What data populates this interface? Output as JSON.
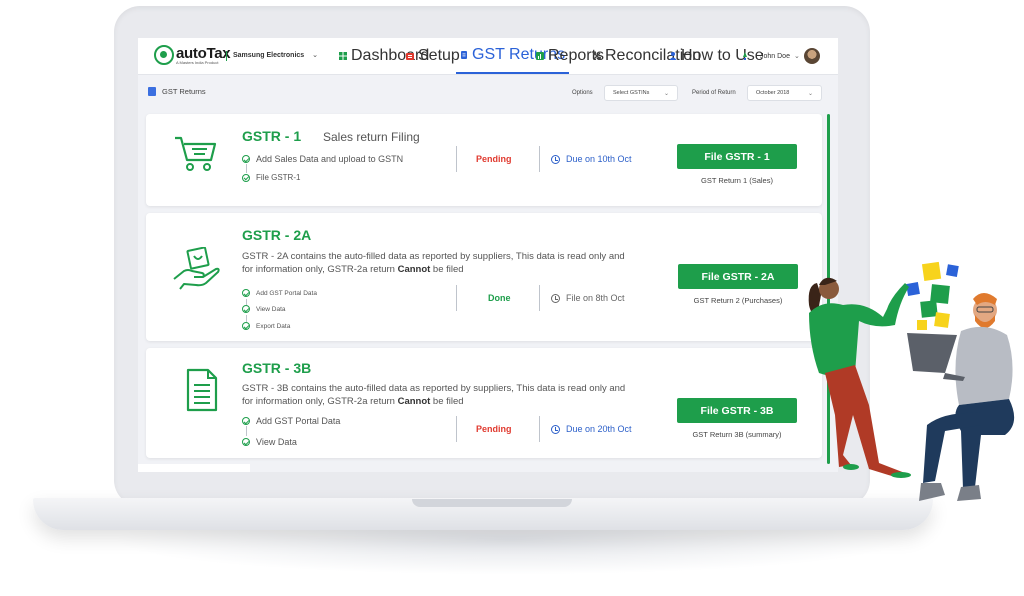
{
  "app": {
    "logo_text": "autoTax",
    "logo_subtext": "A Masters India Product",
    "company": "Samsung Electronics",
    "company_chevron": "⌄"
  },
  "nav": {
    "items": [
      {
        "label": "Dashboard",
        "icon": "dashboard-icon"
      },
      {
        "label": "Setup",
        "icon": "setup-icon"
      },
      {
        "label": "GST Returns",
        "icon": "gst-returns-icon",
        "active": true
      },
      {
        "label": "Reports",
        "icon": "reports-icon"
      },
      {
        "label": "Reconcilation",
        "icon": "reconcilation-icon"
      },
      {
        "label": "How to Use",
        "icon": "how-to-use-icon"
      }
    ],
    "user_name": "John Doe",
    "user_chevron": "⌄"
  },
  "subheader": {
    "title": "GST Returns",
    "options_label": "Options",
    "gstin_select": "Select GSTINs",
    "period_label": "Period of Return",
    "period_select": "October 2018"
  },
  "cards": [
    {
      "title": "GSTR - 1",
      "subtitle": "Sales return Filing",
      "steps": [
        "Add Sales Data and upload to GSTN",
        "File GSTR-1"
      ],
      "status": "Pending",
      "due": "Due on 10th Oct",
      "button": "File GSTR - 1",
      "caption": "GST Return 1 (Sales)"
    },
    {
      "title": "GSTR - 2A",
      "desc_pre": "GSTR - 2A contains the auto-filled data as reported by suppliers, This data is read only and for information only, GSTR-2a return ",
      "desc_bold": "Cannot",
      "desc_post": " be filed",
      "steps": [
        "Add GST Portal Data",
        "View Data",
        "Export Data"
      ],
      "status": "Done",
      "due": "File on 8th Oct",
      "button": "File GSTR - 2A",
      "caption": "GST Return 2 (Purchases)"
    },
    {
      "title": "GSTR - 3B",
      "desc_pre": "GSTR - 3B contains the auto-filled data as reported by suppliers, This data is read only and for information only, GSTR-2a return ",
      "desc_bold": "Cannot",
      "desc_post": " be filed",
      "steps": [
        "Add GST Portal Data",
        "View Data"
      ],
      "status": "Pending",
      "due": "Due on 20th Oct",
      "button": "File GSTR - 3B",
      "caption": "GST Return 3B (summary)"
    }
  ],
  "colors": {
    "brand_green": "#1e9e4b",
    "pending_red": "#e03a2f",
    "due_blue": "#2b5fc9",
    "nav_active": "#2b62d8"
  }
}
